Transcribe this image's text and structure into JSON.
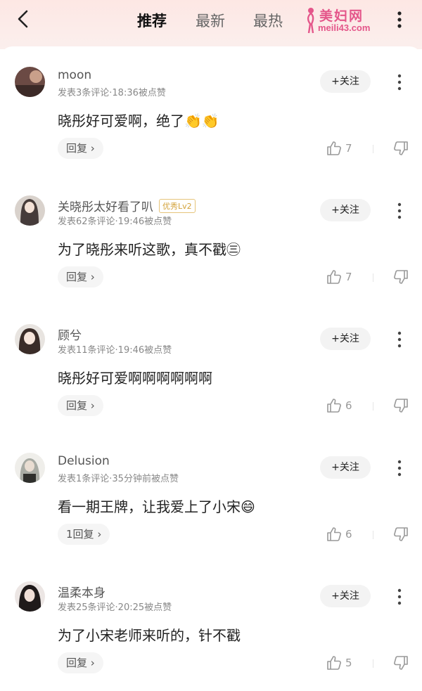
{
  "header": {
    "tabs": [
      {
        "label": "推荐",
        "active": true
      },
      {
        "label": "最新",
        "active": false
      },
      {
        "label": "最热",
        "active": false
      }
    ],
    "watermark": {
      "name": "美妇网",
      "url": "meili43.com"
    }
  },
  "comments": [
    {
      "user": "moon",
      "badge": "",
      "meta": "发表3条评论·18:36被点赞",
      "text": "晓彤好可爱啊，绝了👏👏",
      "reply": "回复",
      "likes": "7",
      "follow": "+关注"
    },
    {
      "user": "关晓彤太好看了叭",
      "badge": "优秀Lv2",
      "meta": "发表62条评论·19:46被点赞",
      "text": "为了晓彤来听这歌，真不戳㊂",
      "reply": "回复",
      "likes": "7",
      "follow": "+关注"
    },
    {
      "user": "顾兮",
      "badge": "",
      "meta": "发表11条评论·19:46被点赞",
      "text": "晓彤好可爱啊啊啊啊啊啊",
      "reply": "回复",
      "likes": "6",
      "follow": "+关注"
    },
    {
      "user": "Delusion",
      "badge": "",
      "meta": "发表1条评论·35分钟前被点赞",
      "text": "看一期王牌，让我爱上了小宋😄",
      "reply": "1回复",
      "likes": "6",
      "follow": "+关注"
    },
    {
      "user": "温柔本身",
      "badge": "",
      "meta": "发表25条评论·20:25被点赞",
      "text": "为了小宋老师来听的，针不戳",
      "reply": "回复",
      "likes": "5",
      "follow": "+关注"
    }
  ],
  "colors": {
    "accent": "#e4568a",
    "header_bg": "#fde7e4"
  }
}
